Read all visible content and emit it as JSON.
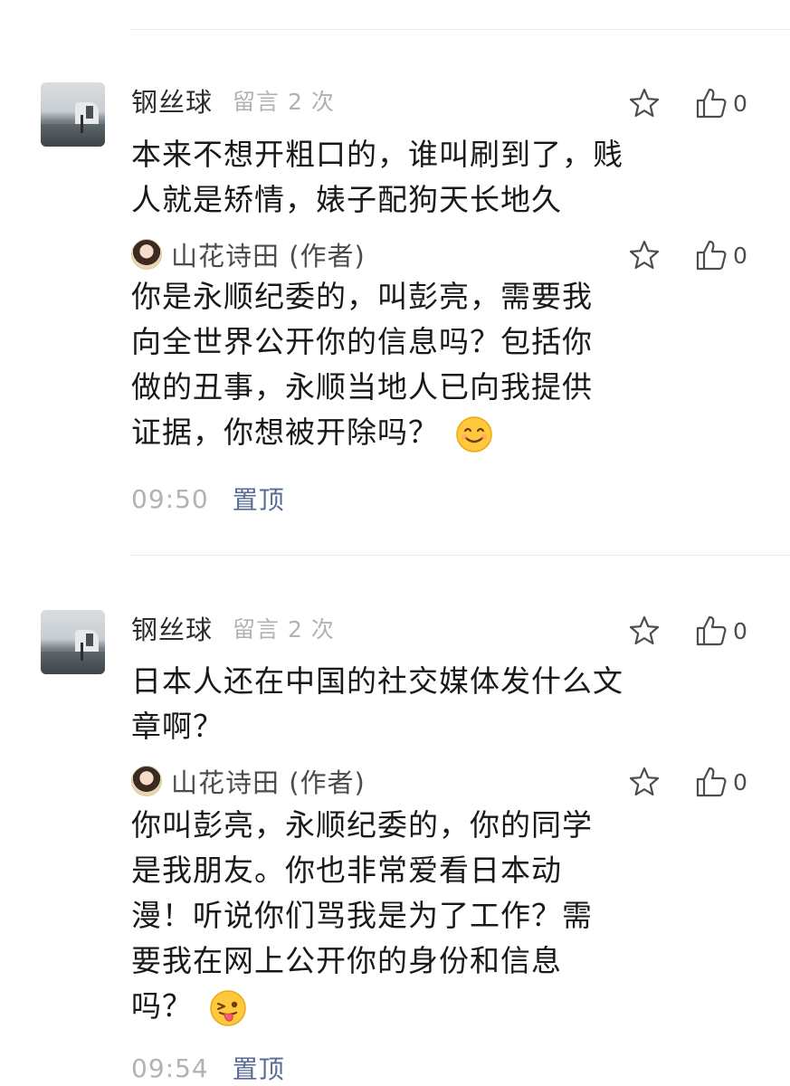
{
  "comments": [
    {
      "author": "钢丝球",
      "meta": "留言 2 次",
      "text_lines": [
        "本来不想开粗口的，谁叫刷到了，贱",
        "人就是矫情，婊子配狗天长地久"
      ],
      "likes": "0",
      "reply": {
        "author": "山花诗田 (作者)",
        "text_lines": [
          "你是永顺纪委的，叫彭亮，需要我",
          "向全世界公开你的信息吗？包括你",
          "做的丑事，永顺当地人已向我提供",
          "证据，你想被开除吗？"
        ],
        "emoji": "smiling-face-emoji",
        "likes": "0"
      },
      "time": "09:50",
      "pin_label": "置顶"
    },
    {
      "author": "钢丝球",
      "meta": "留言 2 次",
      "text_lines": [
        "日本人还在中国的社交媒体发什么文",
        "章啊？"
      ],
      "likes": "0",
      "reply": {
        "author": "山花诗田 (作者)",
        "text_lines": [
          "你叫彭亮，永顺纪委的，你的同学",
          "是我朋友。你也非常爱看日本动",
          "漫！听说你们骂我是为了工作？需",
          "要我在网上公开你的身份和信息",
          "吗？"
        ],
        "emoji": "winking-tongue-emoji",
        "likes": "0"
      },
      "time": "09:54",
      "pin_label": "置顶"
    }
  ],
  "icons": {
    "favorite": "star-icon",
    "like": "thumbs-up-icon"
  },
  "colors": {
    "link": "#576b95",
    "muted": "#b2b2b2",
    "emoji": "#ffc83d"
  }
}
